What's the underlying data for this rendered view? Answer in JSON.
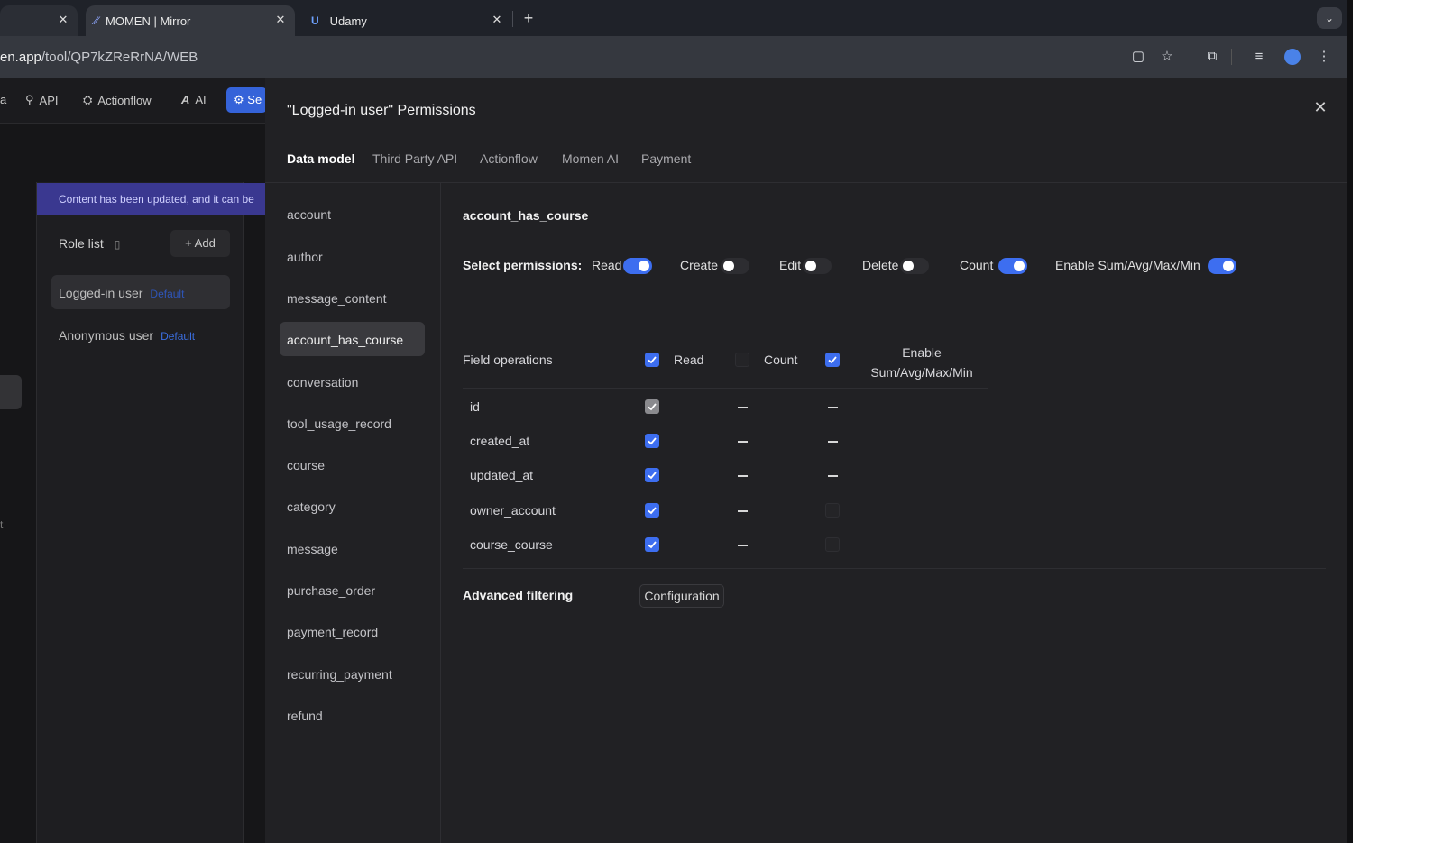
{
  "browser": {
    "tabs": [
      {
        "title": ""
      },
      {
        "title": "MOMEN | Mirror"
      },
      {
        "title": "Udamy"
      }
    ],
    "url_prefix": "en.app",
    "url_path": "/tool/QP7kZReRrNA/WEB"
  },
  "app_nav": {
    "items": [
      {
        "label": "a"
      },
      {
        "label": "API"
      },
      {
        "label": "Actionflow"
      },
      {
        "label": "AI"
      },
      {
        "label": "Se"
      }
    ]
  },
  "left_panel": {
    "banner": "Content has been updated, and it can be",
    "role_list_title": "Role list",
    "add_label": "Add",
    "roles": [
      {
        "name": "Logged-in user",
        "tag": "Default"
      },
      {
        "name": "Anonymous user",
        "tag": "Default"
      }
    ],
    "side_letter": "t"
  },
  "modal": {
    "title": "\"Logged-in user\" Permissions",
    "tabs": [
      "Data model",
      "Third Party API",
      "Actionflow",
      "Momen AI",
      "Payment"
    ],
    "models": [
      "account",
      "author",
      "message_content",
      "account_has_course",
      "conversation",
      "tool_usage_record",
      "course",
      "category",
      "message",
      "purchase_order",
      "payment_record",
      "recurring_payment",
      "refund"
    ],
    "selected_model": "account_has_course",
    "select_permissions_label": "Select permissions:",
    "permissions": [
      {
        "label": "Read",
        "on": true
      },
      {
        "label": "Create",
        "on": false
      },
      {
        "label": "Edit",
        "on": false
      },
      {
        "label": "Delete",
        "on": false
      },
      {
        "label": "Count",
        "on": true
      },
      {
        "label": "Enable Sum/Avg/Max/Min",
        "on": true
      }
    ],
    "field_ops": {
      "label": "Field operations",
      "col_read": "Read",
      "col_count": "Count",
      "col_enable_line1": "Enable",
      "col_enable_line2": "Sum/Avg/Max/Min",
      "header_checks": {
        "read": true,
        "count": false,
        "enable": true
      },
      "fields": [
        {
          "name": "id",
          "read": "gray",
          "count": "dash",
          "enable": "dash"
        },
        {
          "name": "created_at",
          "read": "on",
          "count": "dash",
          "enable": "dash"
        },
        {
          "name": "updated_at",
          "read": "on",
          "count": "dash",
          "enable": "dash"
        },
        {
          "name": "owner_account",
          "read": "on",
          "count": "dash",
          "enable": "off"
        },
        {
          "name": "course_course",
          "read": "on",
          "count": "dash",
          "enable": "off"
        }
      ]
    },
    "advanced_filtering_label": "Advanced filtering",
    "configuration_label": "Configuration"
  },
  "colors": {
    "accent": "#3d6ef0",
    "banner": "#3a3890",
    "modal_bg": "#212124"
  }
}
